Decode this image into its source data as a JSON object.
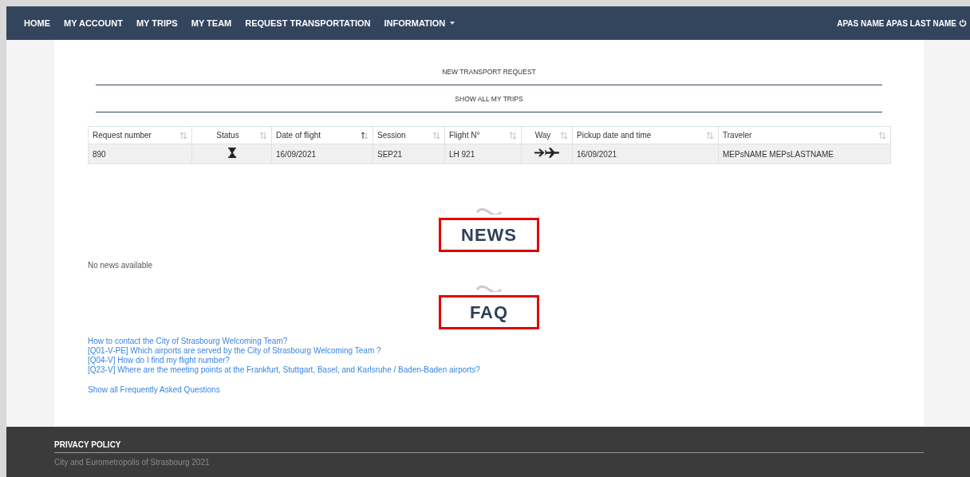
{
  "nav": {
    "items": [
      {
        "label": "HOME",
        "dropdown": false
      },
      {
        "label": "MY ACCOUNT",
        "dropdown": false
      },
      {
        "label": "MY TRIPS",
        "dropdown": false
      },
      {
        "label": "MY TEAM",
        "dropdown": false
      },
      {
        "label": "REQUEST TRANSPORTATION",
        "dropdown": false
      },
      {
        "label": "INFORMATION",
        "dropdown": true
      }
    ],
    "user": "APAS NAME APAS LAST NAME"
  },
  "actions": [
    "NEW TRANSPORT REQUEST",
    "SHOW ALL MY TRIPS"
  ],
  "table": {
    "columns": [
      {
        "label": "Request number",
        "sorted": false
      },
      {
        "label": "Status",
        "sorted": false
      },
      {
        "label": "Date of flight",
        "sorted": true
      },
      {
        "label": "Session",
        "sorted": false
      },
      {
        "label": "Flight N°",
        "sorted": false
      },
      {
        "label": "Way",
        "sorted": false
      },
      {
        "label": "Pickup date and time",
        "sorted": false
      },
      {
        "label": "Traveler",
        "sorted": false
      }
    ],
    "rows": [
      {
        "request_number": "890",
        "pending": true,
        "date_of_flight": "16/09/2021",
        "session": "SEP21",
        "flight": "LH 921",
        "to_airport": true,
        "pickup": "16/09/2021",
        "traveler": "MEPsNAME MEPsLASTNAME"
      }
    ]
  },
  "news": {
    "title": "NEWS",
    "empty_text": "No news available"
  },
  "faq": {
    "title": "FAQ",
    "links": [
      "How to contact the City of Strasbourg Welcoming Team?",
      "[Q01-V-PE] Which airports are served by the City of Strasbourg Welcoming Team ?",
      "[Q04-V] How do I find my flight number?",
      "[Q23-V] Where are the meeting points at the Frankfurt, Stuttgart, Basel, and Karlsruhe / Baden-Baden airports?"
    ],
    "show_all": "Show all Frequently Asked Questions"
  },
  "footer": {
    "link": "PRIVACY POLICY",
    "copyright": "City and Eurometropolis of Strasbourg 2021"
  }
}
